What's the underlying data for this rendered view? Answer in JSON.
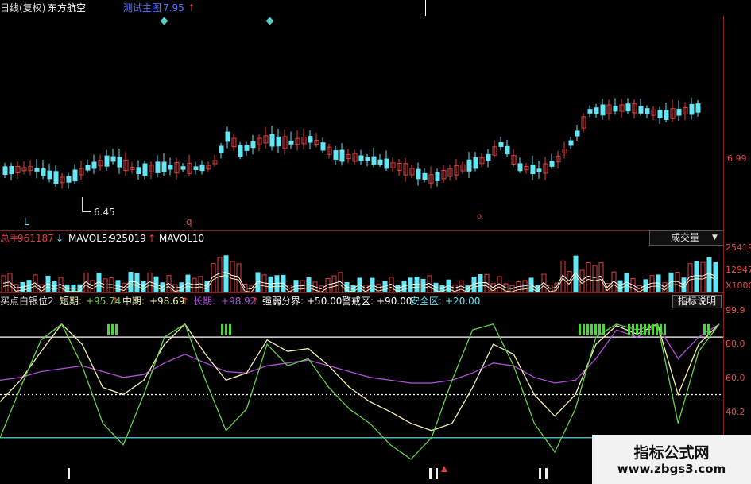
{
  "header": {
    "chart_name": "日线(复权)",
    "stock_name": "东方航空",
    "indicator_label": "测试主图",
    "indicator_value": "7.95",
    "arrow": "↑"
  },
  "price": {
    "axis_label": "6.99",
    "low_label": "6.45",
    "mark_l": "L",
    "mark_q": "q",
    "mark_right": "o"
  },
  "volume": {
    "label_prefix": "总手:",
    "value": "961187",
    "down_arrow": "↓",
    "ma5_label": "MAVOL5:",
    "ma5_value": "925019",
    "up_arrow": "↑",
    "ma10_label": "MAVOL10",
    "axis_top": "25419",
    "axis_mid": "12947",
    "axis_unit": "X1000",
    "selector_value": "成交量",
    "selector_arrow": "▼"
  },
  "indicator": {
    "name": "买点白银位2",
    "short_label": "短期:",
    "short_value": "+95.74",
    "short_arrow": "↑",
    "mid_label": "中期:",
    "mid_value": "+98.69",
    "mid_arrow": "↑",
    "long_label": "长期:",
    "long_value": "+98.92",
    "long_arrow": "↑",
    "boundary_label": "强弱分界:",
    "boundary_value": "+50.00",
    "warning_label": "警戒区:",
    "warning_value": "+90.00",
    "safe_label": "安全区:",
    "safe_value": "+20.00",
    "explain_button": "指标说明",
    "axis": [
      "99.9",
      "80.0",
      "60.0",
      "40.2"
    ]
  },
  "colors": {
    "up": "#e04040",
    "down": "#66e5f5",
    "yellow": "#f4f0b0",
    "purple": "#b050d8",
    "green": "#66d04a",
    "axis_red": "#e54b4b"
  },
  "watermark": {
    "title": "指标公式网",
    "url": "www.zbgs3.com"
  },
  "chart_data": {
    "type": "line",
    "title": "",
    "series": [
      {
        "name": "短期",
        "values": [
          20,
          55,
          88,
          99,
          70,
          30,
          15,
          50,
          90,
          99,
          60,
          25,
          40,
          85,
          70,
          75,
          55,
          40,
          30,
          15,
          5,
          20,
          60,
          95,
          99,
          70,
          30,
          10,
          40,
          90,
          99,
          95,
          99,
          30,
          80,
          99
        ]
      },
      {
        "name": "中期",
        "values": [
          45,
          60,
          80,
          99,
          85,
          55,
          50,
          60,
          85,
          99,
          78,
          60,
          65,
          88,
          80,
          82,
          70,
          55,
          45,
          38,
          30,
          25,
          30,
          55,
          85,
          78,
          50,
          35,
          50,
          85,
          98,
          92,
          99,
          50,
          85,
          99
        ]
      },
      {
        "name": "长期",
        "values": [
          60,
          62,
          66,
          68,
          70,
          66,
          62,
          64,
          72,
          78,
          72,
          66,
          65,
          70,
          72,
          74,
          70,
          66,
          62,
          60,
          58,
          58,
          60,
          65,
          72,
          70,
          62,
          58,
          60,
          75,
          95,
          90,
          98,
          75,
          90,
          99
        ]
      }
    ],
    "reference_lines": [
      90,
      50,
      20
    ]
  }
}
